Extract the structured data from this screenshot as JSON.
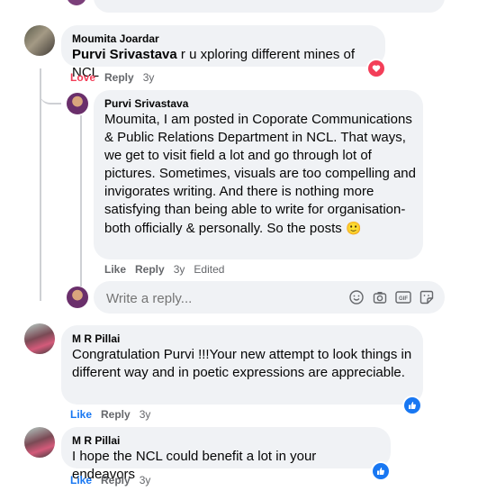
{
  "comments": [
    {
      "author": "Moumita Joardar",
      "mention": "Purvi Srivastava",
      "text": " r u xploring different mines of NCL",
      "actions": {
        "react": "Love",
        "reply": "Reply",
        "time": "3y"
      },
      "reaction": "love"
    },
    {
      "author": "Purvi Srivastava",
      "text": "Moumita, I am posted in Coporate Communications & Public Relations Department in NCL. That ways, we get to visit field a lot and go through lot of pictures. Sometimes, visuals are too compelling and invigorates writing. And there is nothing more satisfying than being able to write for organisation- both officially & personally. So the posts",
      "emoji": "🙂",
      "actions": {
        "react": "Like",
        "reply": "Reply",
        "time": "3y",
        "edited": "Edited"
      }
    },
    {
      "author": "M R Pillai",
      "text": "Congratulation Purvi !!!Your new attempt to look things in different way and in poetic expressions are appreciable.",
      "actions": {
        "react": "Like",
        "reply": "Reply",
        "time": "3y"
      },
      "reaction": "like"
    },
    {
      "author": "M R Pillai",
      "text": "I hope the NCL could benefit a lot in your endeavors",
      "actions": {
        "react": "Like",
        "reply": "Reply",
        "time": "3y"
      },
      "reaction": "like"
    }
  ],
  "reply_box": {
    "placeholder": "Write a reply...",
    "icons": [
      "emoji-icon",
      "camera-icon",
      "gif-icon",
      "sticker-icon"
    ]
  },
  "colors": {
    "love": "#f33e58",
    "like": "#1877f2",
    "bubble": "#f0f2f5",
    "meta": "#65676b"
  }
}
